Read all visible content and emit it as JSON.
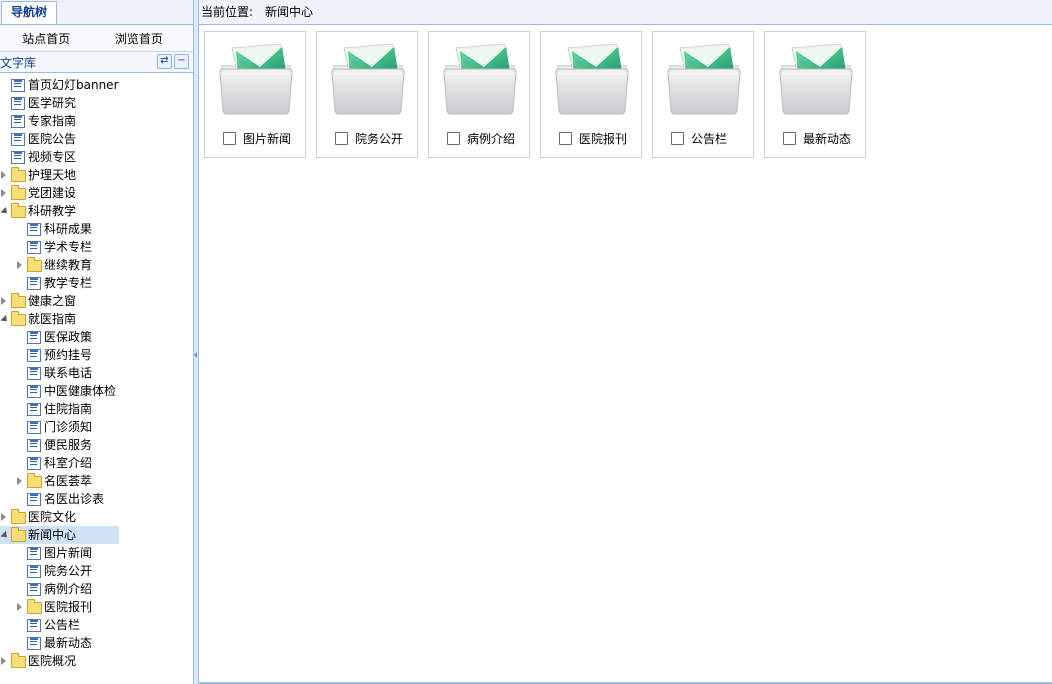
{
  "nav_tab": "导航树",
  "top_links": [
    "站点首页",
    "浏览首页"
  ],
  "section_title": "文字库",
  "breadcrumb": {
    "label": "当前位置:",
    "value": "新闻中心"
  },
  "tree": [
    {
      "label": "首页幻灯banner",
      "type": "doc",
      "level": 0
    },
    {
      "label": "医学研究",
      "type": "doc",
      "level": 0
    },
    {
      "label": "专家指南",
      "type": "doc",
      "level": 0
    },
    {
      "label": "医院公告",
      "type": "doc",
      "level": 0
    },
    {
      "label": "视频专区",
      "type": "doc",
      "level": 0
    },
    {
      "label": "护理天地",
      "type": "folder",
      "level": 0,
      "expander": "collapsed"
    },
    {
      "label": "党团建设",
      "type": "folder",
      "level": 0,
      "expander": "collapsed"
    },
    {
      "label": "科研教学",
      "type": "folder",
      "level": 0,
      "expander": "expanded"
    },
    {
      "label": "科研成果",
      "type": "doc",
      "level": 1
    },
    {
      "label": "学术专栏",
      "type": "doc",
      "level": 1
    },
    {
      "label": "继续教育",
      "type": "folder",
      "level": 1,
      "expander": "collapsed"
    },
    {
      "label": "教学专栏",
      "type": "doc",
      "level": 1
    },
    {
      "label": "健康之窗",
      "type": "folder",
      "level": 0,
      "expander": "collapsed"
    },
    {
      "label": "就医指南",
      "type": "folder",
      "level": 0,
      "expander": "expanded"
    },
    {
      "label": "医保政策",
      "type": "doc",
      "level": 1
    },
    {
      "label": "预约挂号",
      "type": "doc",
      "level": 1
    },
    {
      "label": "联系电话",
      "type": "doc",
      "level": 1
    },
    {
      "label": "中医健康体检",
      "type": "doc",
      "level": 1
    },
    {
      "label": "住院指南",
      "type": "doc",
      "level": 1
    },
    {
      "label": "门诊须知",
      "type": "doc",
      "level": 1
    },
    {
      "label": "便民服务",
      "type": "doc",
      "level": 1
    },
    {
      "label": "科室介绍",
      "type": "doc",
      "level": 1
    },
    {
      "label": "名医荟萃",
      "type": "folder",
      "level": 1,
      "expander": "collapsed"
    },
    {
      "label": "名医出诊表",
      "type": "doc",
      "level": 1
    },
    {
      "label": "医院文化",
      "type": "folder",
      "level": 0,
      "expander": "collapsed"
    },
    {
      "label": "新闻中心",
      "type": "folder",
      "level": 0,
      "expander": "expanded",
      "selected": true
    },
    {
      "label": "图片新闻",
      "type": "doc",
      "level": 1
    },
    {
      "label": "院务公开",
      "type": "doc",
      "level": 1
    },
    {
      "label": "病例介绍",
      "type": "doc",
      "level": 1
    },
    {
      "label": "医院报刊",
      "type": "folder",
      "level": 1,
      "expander": "collapsed"
    },
    {
      "label": "公告栏",
      "type": "doc",
      "level": 1
    },
    {
      "label": "最新动态",
      "type": "doc",
      "level": 1
    },
    {
      "label": "医院概况",
      "type": "folder",
      "level": 0,
      "expander": "collapsed"
    }
  ],
  "folders": [
    {
      "label": "图片新闻",
      "checked": false
    },
    {
      "label": "院务公开",
      "checked": false
    },
    {
      "label": "病例介绍",
      "checked": false
    },
    {
      "label": "医院报刊",
      "checked": false
    },
    {
      "label": "公告栏",
      "checked": false
    },
    {
      "label": "最新动态",
      "checked": false
    }
  ],
  "colors": {
    "accent": "#15428b",
    "border": "#99bbe8",
    "selected": "#cfe2f6"
  }
}
